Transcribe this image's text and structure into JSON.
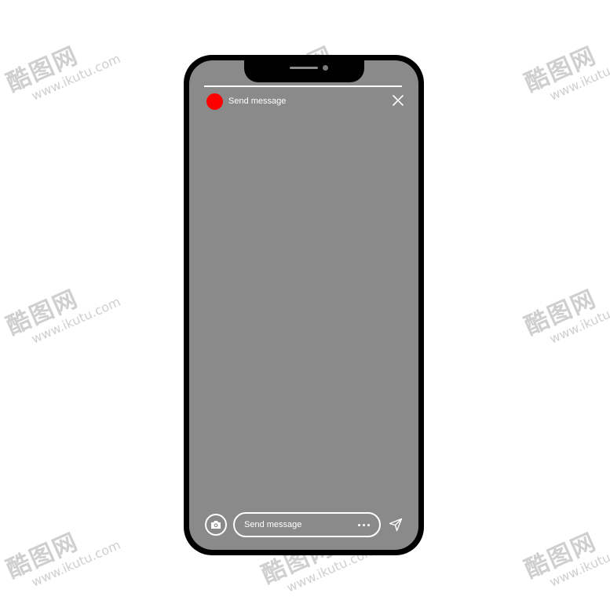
{
  "watermark": {
    "brand": "酷图网",
    "url": "www.ikutu.com"
  },
  "story": {
    "header_label": "Send message",
    "avatar_color": "#ff0000",
    "screen_color": "#8a8a8a",
    "icons": {
      "close": "close-icon",
      "camera": "camera-icon",
      "more": "more-dots-icon",
      "send": "send-icon"
    }
  },
  "composer": {
    "placeholder": "Send message"
  }
}
